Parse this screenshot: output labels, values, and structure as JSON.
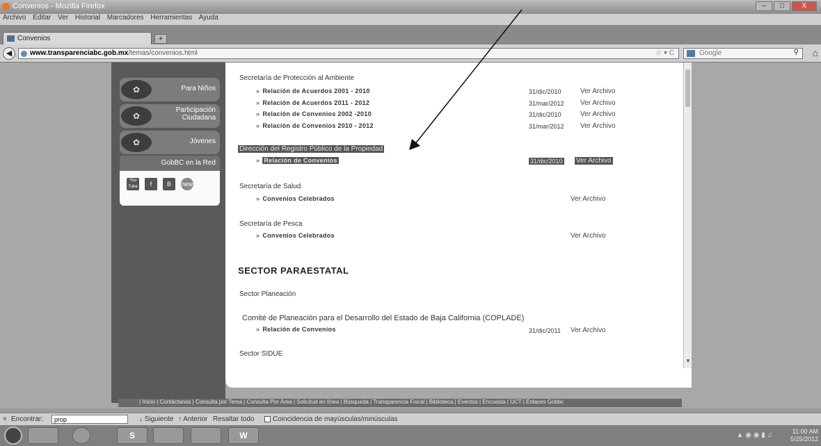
{
  "window": {
    "title": "Convenios - Mozilla Firefox",
    "controls": [
      "–",
      "□",
      "X"
    ]
  },
  "menubar": [
    "Archivo",
    "Editar",
    "Ver",
    "Historial",
    "Marcadores",
    "Herramientas",
    "Ayuda"
  ],
  "tab": {
    "label": "Convenios",
    "new_tab": "+"
  },
  "url": {
    "domain": "www.transparenciabc.gob.mx",
    "path": "/temas/convenios.html",
    "icons": "☆ ▾ C"
  },
  "search": {
    "placeholder": "Google"
  },
  "sidebar": {
    "items": [
      {
        "label": "Para Niños",
        "icon": "children-icon"
      },
      {
        "label": "Participación Ciudadana",
        "icon": "citizens-icon"
      },
      {
        "label": "Jóvenes",
        "icon": "youth-icon"
      }
    ],
    "social_title": "GobBC en la Red",
    "social": [
      "You Tube",
      "f",
      "B",
      "new"
    ]
  },
  "content": {
    "sections": [
      {
        "title": "Secretaría de Protección al Ambiente",
        "rows": [
          {
            "label": "Relación de Acuerdos 2001 - 2010",
            "date": "31/dic/2010",
            "link": "Ver Archivo"
          },
          {
            "label": "Relación de Acuerdos 2011 - 2012",
            "date": "31/mar/2012",
            "link": "Ver Archivo"
          },
          {
            "label": "Relación de Convenios 2002 -2010",
            "date": "31/dic/2010",
            "link": "Ver Archivo"
          },
          {
            "label": "Relación de Convenios 2010 - 2012",
            "date": "31/mar/2012",
            "link": "Ver Archivo"
          }
        ]
      },
      {
        "title": "Dirección del Registro Público de la Propiedad",
        "rows": [
          {
            "label": "Relación de Convenios",
            "date": "31/dic/2010",
            "link": "Ver Archivo"
          }
        ]
      },
      {
        "title": "Secretaría de Salud",
        "rows": [
          {
            "label": "Convenios Celebrados",
            "date": "",
            "link": "Ver Archivo"
          }
        ]
      },
      {
        "title": "Secretaría de Pesca",
        "rows": [
          {
            "label": "Convenios Celebrados",
            "date": "",
            "link": "Ver Archivo"
          }
        ]
      }
    ],
    "sector_heading": "SECTOR PARAESTATAL",
    "sector_planeacion": "Sector Planeación",
    "coplade": {
      "title": "Comité de Planeación para el Desarrollo del Estado de Baja California (COPLADE)",
      "row": {
        "label": "Relación de Convenios",
        "date": "31/dic/2011",
        "link": "Ver Archivo"
      }
    },
    "sector_sidue": "Sector SIDUE"
  },
  "footer": "| Inicio | Contáctanos | Consulta por Tema | Consulta Por Área | Solicitud en línea | Búsqueda | Transparencia Fiscal | Biblioteca | Eventos | Encuesta | UCT | Enlaces Gobbc",
  "findbar": {
    "close": "×",
    "label": "Encontrar:",
    "value": "prop",
    "next": "Siguiente",
    "prev": "Anterior",
    "highlight": "Resaltar todo",
    "match_case": "Coincidencia de mayúsculas/minúsculas"
  },
  "taskbar": {
    "apps": [
      "",
      "",
      "S",
      "",
      "",
      "W"
    ],
    "clock_time": "11:00 AM",
    "clock_date": "5/25/2012"
  }
}
